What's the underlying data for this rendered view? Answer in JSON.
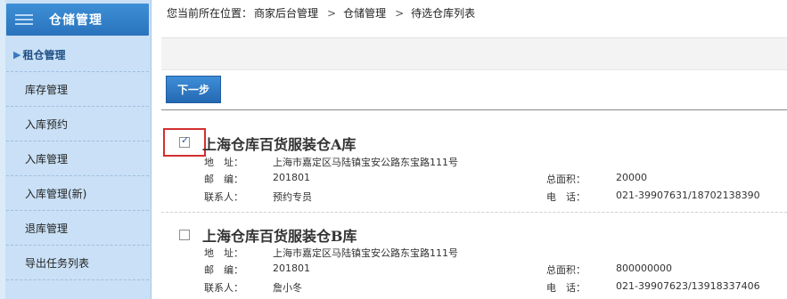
{
  "sidebar": {
    "header": "仓储管理",
    "items": [
      {
        "label": "租仓管理",
        "active": true
      },
      {
        "label": "库存管理"
      },
      {
        "label": "入库预约"
      },
      {
        "label": "入库管理"
      },
      {
        "label": "入库管理(新)"
      },
      {
        "label": "退库管理"
      },
      {
        "label": "导出任务列表"
      }
    ]
  },
  "breadcrumb": {
    "prefix": "您当前所在位置：",
    "crumbs": [
      "商家后台管理",
      "仓储管理",
      "待选仓库列表"
    ],
    "sep": ">"
  },
  "toolbar": {
    "next_label": "下一步"
  },
  "warehouses": [
    {
      "name": "上海仓库百货服装仓A库",
      "checked": true,
      "address_label": "地　址：",
      "address": "上海市嘉定区马陆镇宝安公路东宝路111号",
      "zip_label": "邮　编：",
      "zip": "201801",
      "contact_label": "联系人：",
      "contact": "预约专员",
      "area_label": "总面积：",
      "area": "20000",
      "phone_label": "电　话：",
      "phone": "021-39907631/18702138390"
    },
    {
      "name": "上海仓库百货服装仓B库",
      "checked": false,
      "address_label": "地　址：",
      "address": "上海市嘉定区马陆镇宝安公路东宝路111号",
      "zip_label": "邮　编：",
      "zip": "201801",
      "contact_label": "联系人：",
      "contact": "詹小冬",
      "area_label": "总面积：",
      "area": "800000000",
      "phone_label": "电　话：",
      "phone": "021-39907623/13918337406"
    }
  ]
}
